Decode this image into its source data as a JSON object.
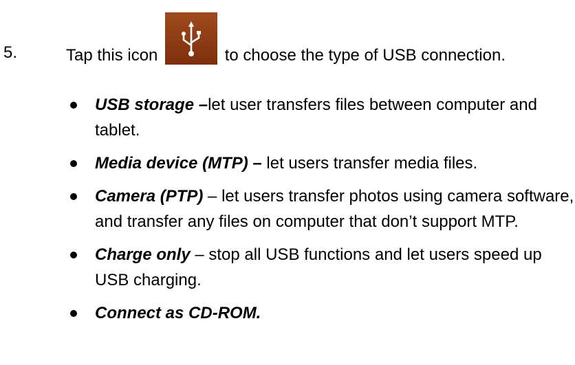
{
  "step": {
    "number": "5.",
    "text_before_icon": "Tap this icon ",
    "icon": "usb-icon",
    "icon_color": "#8e3a10",
    "text_after_icon": " to choose the type of USB connection."
  },
  "options": [
    {
      "term": "USB storage –",
      "description": "let user transfers files between computer and tablet."
    },
    {
      "term": "Media device (MTP) –",
      "description": " let users transfer media files."
    },
    {
      "term": "Camera (PTP)",
      "description": " – let users transfer photos using camera software, and transfer any files on computer that don’t support MTP."
    },
    {
      "term": "Charge only",
      "description": " – stop all USB functions and let users speed up USB charging."
    },
    {
      "term": "Connect as CD-ROM.",
      "description": ""
    }
  ]
}
